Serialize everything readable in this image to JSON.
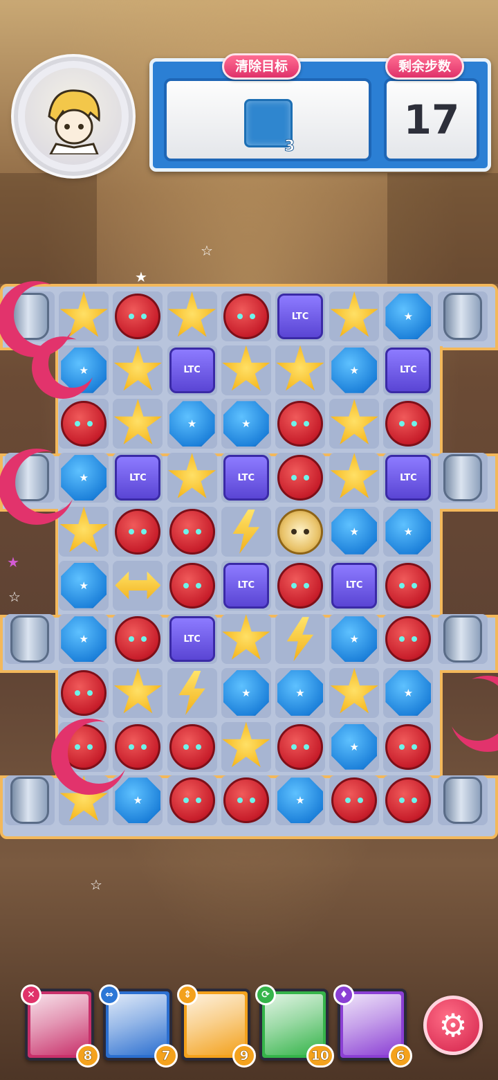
{
  "header": {
    "avatar_icon": "hero-portrait",
    "target_label": "清除目标",
    "target_tile_icon": "blue-tile-icon",
    "target_count": "3",
    "steps_label": "剩余步数",
    "steps_value": "17"
  },
  "board": {
    "rows": [
      [
        "jar-edge",
        "yellow",
        "red",
        "yellow",
        "red",
        "purple",
        "yellow",
        "blue",
        "jar"
      ],
      [
        "none",
        "blue",
        "yellow",
        "purple",
        "yellow",
        "yellow",
        "blue",
        "purple",
        "none"
      ],
      [
        "none",
        "red",
        "yellow",
        "blue",
        "blue",
        "red",
        "yellow",
        "red",
        "none"
      ],
      [
        "jar-edge",
        "blue",
        "purple",
        "yellow",
        "purple",
        "red",
        "yellow",
        "purple",
        "jar"
      ],
      [
        "none",
        "yellow",
        "red",
        "red",
        "bolt",
        "gold",
        "blue",
        "blue",
        "none"
      ],
      [
        "none",
        "blue",
        "arrow",
        "red",
        "purple",
        "red",
        "purple",
        "red",
        "none"
      ],
      [
        "jar",
        "blue",
        "red",
        "purple",
        "yellow",
        "bolt",
        "blue",
        "red",
        "jar"
      ],
      [
        "none",
        "red",
        "yellow",
        "bolt",
        "blue",
        "blue",
        "yellow",
        "blue",
        "none"
      ],
      [
        "none",
        "red",
        "red",
        "red",
        "yellow",
        "red",
        "blue",
        "red",
        "none"
      ],
      [
        "jar",
        "yellow",
        "blue",
        "red",
        "red",
        "blue",
        "red",
        "red",
        "jar"
      ]
    ]
  },
  "heroes": [
    {
      "skill_icon": "cross-icon",
      "skill_color": "#e0336a",
      "color": "#c8306a",
      "cost": "8"
    },
    {
      "skill_icon": "horizontal-arrows-icon",
      "skill_color": "#2c77d6",
      "color": "#2b6fd0",
      "cost": "7"
    },
    {
      "skill_icon": "vertical-arrows-icon",
      "skill_color": "#f3a11c",
      "color": "#f3a11c",
      "cost": "9"
    },
    {
      "skill_icon": "refresh-icon",
      "skill_color": "#35b44a",
      "color": "#35b44a",
      "cost": "10"
    },
    {
      "skill_icon": "potion-icon",
      "skill_color": "#8b3fd4",
      "color": "#8b3fd4",
      "cost": "6"
    }
  ],
  "settings_icon": "gear-icon"
}
